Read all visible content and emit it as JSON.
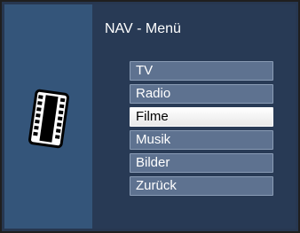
{
  "header": {
    "title": "NAV - Menü"
  },
  "menu": {
    "items": [
      {
        "label": "TV",
        "selected": false
      },
      {
        "label": "Radio",
        "selected": false
      },
      {
        "label": "Filme",
        "selected": true
      },
      {
        "label": "Musik",
        "selected": false
      },
      {
        "label": "Bilder",
        "selected": false
      },
      {
        "label": "Zurück",
        "selected": false
      }
    ]
  },
  "icons": {
    "section_icon": "film-strip-icon"
  },
  "colors": {
    "background": "#283a55",
    "left_panel": "#34557a",
    "menu_item": "#5e7290",
    "menu_item_selected": "#ffffff"
  }
}
